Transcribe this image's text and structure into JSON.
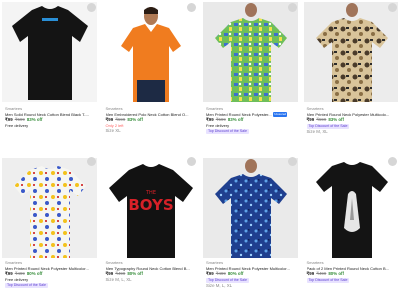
{
  "products": [
    {
      "brand": "Smartees",
      "title": "Men Solid Round Neck Cotton Blend Black T-...",
      "price": "₹99",
      "mrp": "₹599",
      "discount": "83% off",
      "delivery": "Free delivery",
      "chest": "",
      "sizes": "",
      "badge": ""
    },
    {
      "brand": "Smartees",
      "title": "Men Embroidered Polo Neck Cotton Blend O...",
      "price": "₹99",
      "mrp": "₹599",
      "discount": "83% off",
      "delivery": "",
      "chest": "Only 2 left",
      "sizes": "Size XL",
      "badge": ""
    },
    {
      "brand": "Smartees",
      "title": "Men Printed Round Neck Polyester...",
      "price": "₹99",
      "mrp": "₹599",
      "discount": "83% off",
      "delivery": "Free delivery",
      "chest": "",
      "sizes": "",
      "badge": "Top Discount of the Sale",
      "assured": "f Assured"
    },
    {
      "brand": "Smartees",
      "title": "Men Printed Round Neck Polyester Multicolo...",
      "price": "₹99",
      "mrp": "₹599",
      "discount": "83% off",
      "delivery": "",
      "chest": "",
      "sizes": "Size M, XL",
      "badge": "Top Discount of the Sale"
    },
    {
      "brand": "Smartees",
      "title": "Men Printed Round Neck Polyester Multicolor...",
      "price": "₹99",
      "mrp": "₹499",
      "discount": "80% off",
      "delivery": "Free delivery",
      "chest": "",
      "sizes": "",
      "badge": "Top Discount of the Sale"
    },
    {
      "brand": "Smartees",
      "title": "Men Typography Round Neck Cotton Blend B...",
      "price": "₹99",
      "mrp": "₹499",
      "discount": "80% off",
      "delivery": "",
      "chest": "",
      "sizes": "Size M, L, XL",
      "badge": ""
    },
    {
      "brand": "Smartees",
      "title": "Men Printed Round Neck Polyester Multicolor...",
      "price": "₹99",
      "mrp": "₹499",
      "discount": "80% off",
      "delivery": "",
      "chest": "",
      "sizes": "Size M, L, XL",
      "badge": "Top Discount of the Sale"
    },
    {
      "brand": "Smartees",
      "title": "Pack of 2 Men Printed Round Neck Cotton B...",
      "price": "₹99",
      "mrp": "₹499",
      "discount": "80% off",
      "delivery": "",
      "chest": "",
      "sizes": "",
      "badge": "Top Discount of the Sale"
    }
  ],
  "graphics": {
    "boys_text": "THE BOYS",
    "logo_text": "SMARTEES",
    "colors": {
      "orange": "#f07c1f",
      "black": "#121212",
      "red": "#d62128",
      "green": "#388e3c"
    }
  }
}
